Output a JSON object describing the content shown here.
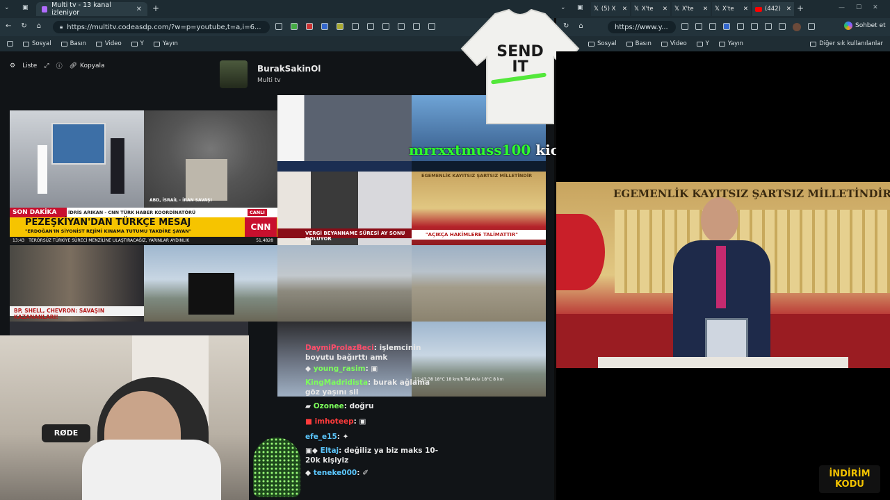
{
  "browser_left": {
    "tab_title": "Multi tv - 13 kanal izleniyor",
    "url": "https://multitv.codeasdp.com/?w=p=youtube,t=a,i=6...",
    "bookmarks": [
      "Sosyal",
      "Basın",
      "Video",
      "Y",
      "Yayın"
    ]
  },
  "browser_right": {
    "tabs": [
      "(5) X",
      "X'te",
      "X'te",
      "X'te",
      "(442)"
    ],
    "url": "https://www.y...",
    "bookmarks": [
      "Sosyal",
      "Basın",
      "Video",
      "Y",
      "Yayın"
    ],
    "other_bookmarks": "Diğer sık kullanılanlar",
    "chat_button": "Sohbet et"
  },
  "multitv": {
    "toolbar": {
      "list": "Liste",
      "copy": "Kopyala"
    },
    "channel_name": "BurakSakinOl",
    "channel_sub": "Multi tv"
  },
  "news": {
    "cnn_breaking": "SON DAKİKA",
    "cnn_person": "İDRİS ARIKAN - CNN TÜRK HABER KOORDİNATÖRÜ",
    "cnn_headline": "PEZEŞKİYAN'DAN TÜRKÇE MESAJ",
    "cnn_sub": "\"ERDOĞAN'IN SİYONİST REJİMİ KINAMA TUTUMU TAKDİRE ŞAYAN\"",
    "cnn_ticker": "TERÖRSÜZ TÜRKİYE SÜRECİ MENZİLİNE ULAŞTIRACAĞIZ, YARINLAR AYDINLIK",
    "cnn_time": "13:43",
    "cnn_score": "51,4828",
    "cnn_live": "CANLI",
    "war_caption": "ABD, İSRAİL - İRAN SAVAŞI",
    "oil_headline": "BP, SHELL, CHEVRON: SAVAŞIN KAZANANLARI!",
    "tax_headline": "VERGİ BEYANNAME SÜRESİ AY SONU DOLUYOR",
    "judge_headline": "\"AÇIKÇA HAKİMLERE TALİMATTIR\"",
    "parliament_banner": "EGEMENLİK KAYITSIZ ŞARTSIZ MİLLETİNDİR",
    "parliament_banner_small": "EGEMENLİK KAYITSIZ ŞARTSIZ MİLLETİNDİR",
    "weather_strip": "12:43:38  18°C  18 km/h  Tel Aviv 18°C  8 km"
  },
  "alert": {
    "user": "mrrxxtmuss",
    "amount": "100",
    "text": "kicks bağışladı!",
    "shirt_text_1": "SEND",
    "shirt_text_2": "IT"
  },
  "chat": [
    {
      "user": "DaymiProlazBeci",
      "msg": "işlemcinin boyutu bağırttı amk",
      "color": "#ff4d6a"
    },
    {
      "user": "young_rasim",
      "msg": "",
      "color": "#7dff5c"
    },
    {
      "user": "KingMadridista",
      "msg": "burak ağlama göz yaşını sil",
      "color": "#7dff5c"
    },
    {
      "user": "Ozonee",
      "msg": "doğru",
      "color": "#7dff5c"
    },
    {
      "user": "imhoteep",
      "msg": "",
      "color": "#ff3b3b"
    },
    {
      "user": "efe_e15",
      "msg": "",
      "color": "#5cc8ff"
    },
    {
      "user": "Eltaj",
      "msg": "değiliz ya biz maks 10-20k kişiyiz",
      "color": "#5cc8ff"
    },
    {
      "user": "teneke000",
      "msg": "",
      "color": "#5cc8ff"
    }
  ],
  "webcam": {
    "mic_brand": "RØDE"
  },
  "promo": {
    "line1": "İNDİRİM",
    "line2": "KODU"
  },
  "colors": {
    "cnn_red": "#c8102e",
    "tab_bg": "#1d2b32",
    "promo_gold": "#f2c200"
  }
}
